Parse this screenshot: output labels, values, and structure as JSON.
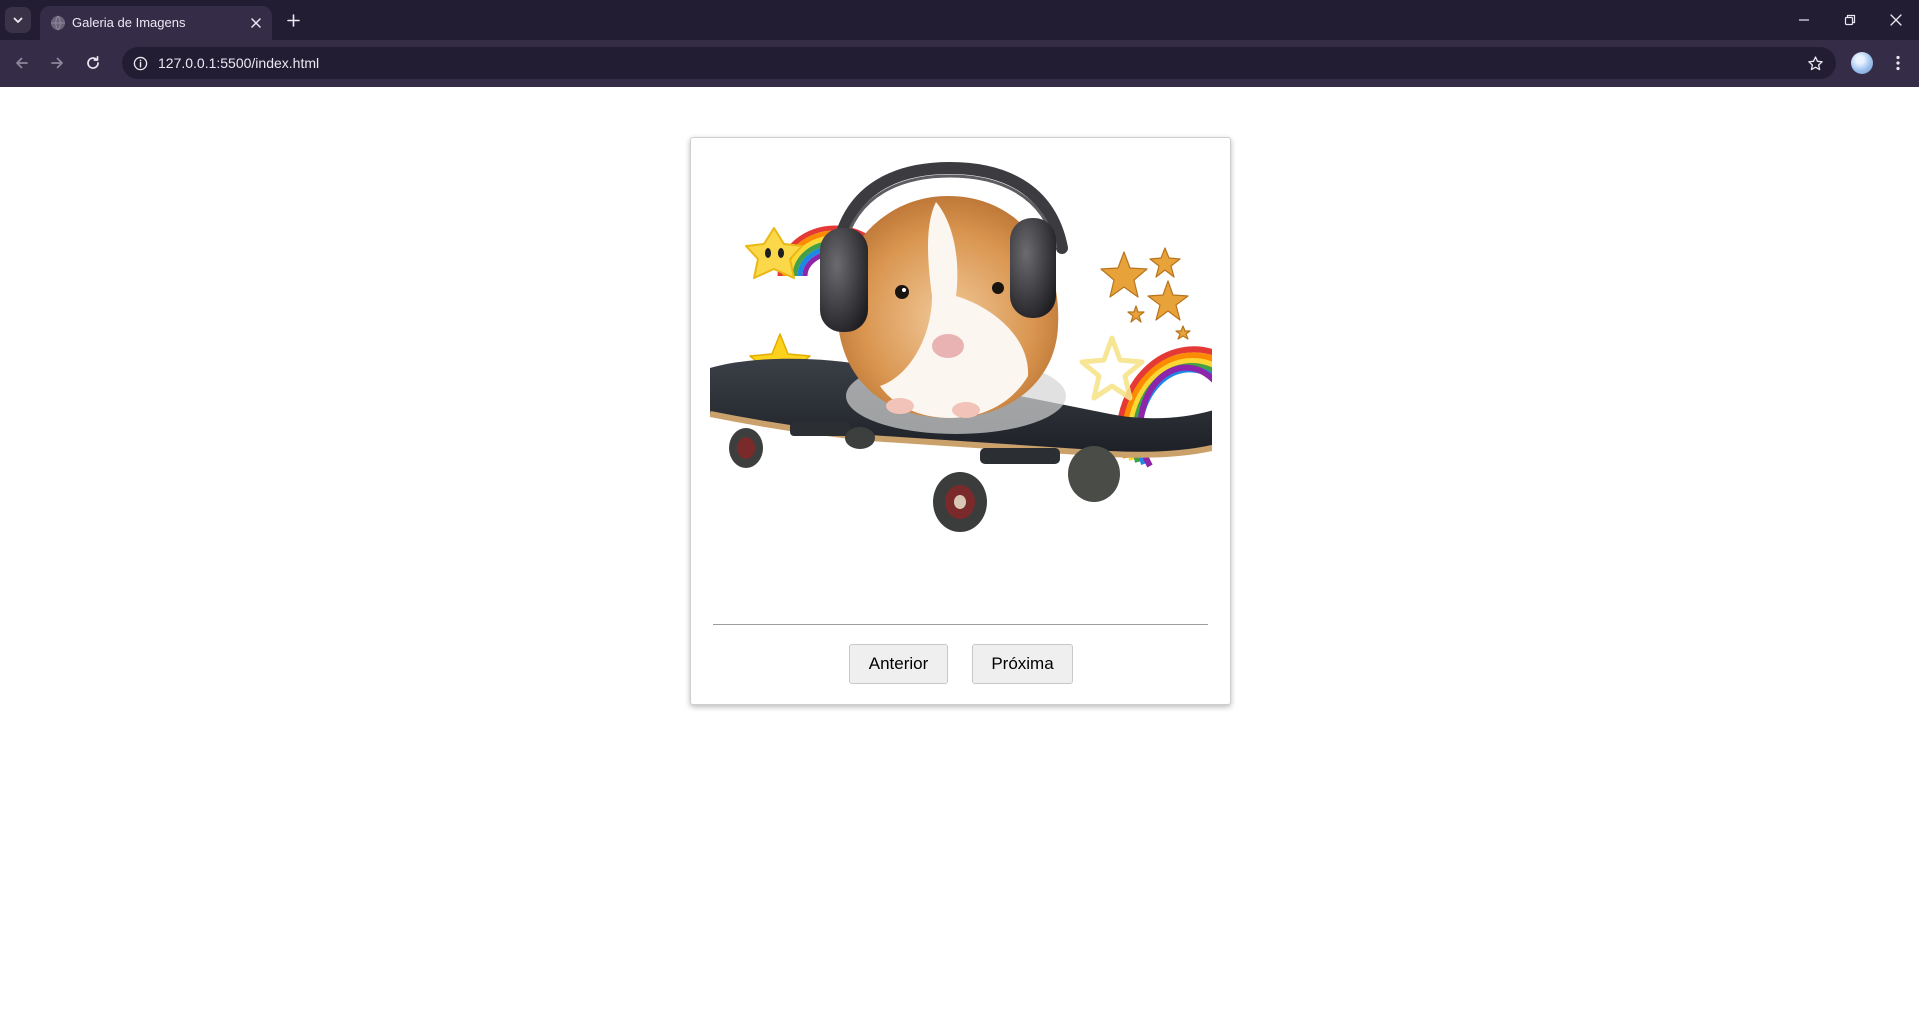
{
  "browser": {
    "tab_title": "Galeria de Imagens",
    "url": "127.0.0.1:5500/index.html"
  },
  "gallery": {
    "prev_label": "Anterior",
    "next_label": "Próxima",
    "image": "guinea pig wearing headphones on a skateboard with rainbows and stars"
  },
  "colors": {
    "tabstrip_bg": "#231d33",
    "toolbar_bg": "#352d47",
    "button_bg": "#efefef"
  },
  "icons": [
    "tab-search-icon",
    "globe-icon",
    "close-icon",
    "plus-icon",
    "minimize-icon",
    "restore-icon",
    "back-icon",
    "forward-icon",
    "reload-icon",
    "info-icon",
    "star-icon",
    "menu-icon"
  ]
}
